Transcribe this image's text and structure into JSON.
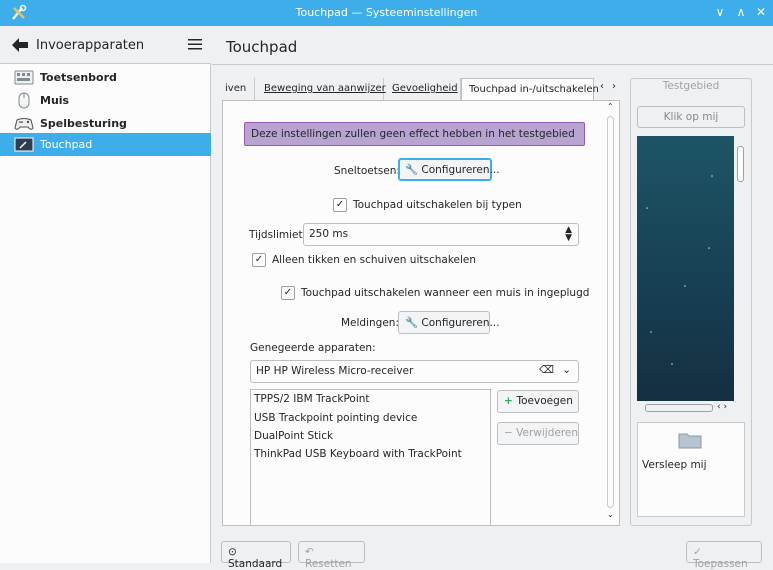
{
  "window": {
    "title": "Touchpad — Systeeminstellingen"
  },
  "sidebar": {
    "header": "Invoerapparaten",
    "items": [
      {
        "label": "Toetsenbord",
        "icon": "keyboard-icon"
      },
      {
        "label": "Muis",
        "icon": "mouse-icon"
      },
      {
        "label": "Spelbesturing",
        "icon": "gamepad-icon"
      },
      {
        "label": "Touchpad",
        "icon": "touchpad-icon",
        "active": true
      }
    ]
  },
  "page_title": "Touchpad",
  "tabs": [
    {
      "label": "iven"
    },
    {
      "label": "Beweging van aanwijzer"
    },
    {
      "label": "Gevoeligheid"
    },
    {
      "label": "Touchpad in-/uitschakelen",
      "active": true
    }
  ],
  "content": {
    "warning": "Deze instellingen zullen geen effect hebben in het testgebied",
    "shortcuts_label": "Sneltoetsen:",
    "configure_label": "Configureren...",
    "disable_typing": "Touchpad uitschakelen bij typen",
    "timeout_label": "Tijdslimiet:",
    "timeout_value": "250 ms",
    "only_tap_scroll": "Alleen tikken en schuiven uitschakelen",
    "disable_mouse": "Touchpad uitschakelen wanneer een muis in ingeplugd",
    "notifications_label": "Meldingen:",
    "ignored_label": "Genegeerde apparaten:",
    "device_input": "HP HP Wireless Micro-receiver",
    "devices": [
      "TPPS/2 IBM TrackPoint",
      "USB Trackpoint pointing device",
      "DualPoint Stick",
      "ThinkPad USB Keyboard with TrackPoint"
    ],
    "add_label": "Toevoegen",
    "remove_label": "Verwijderen"
  },
  "test_area": {
    "title": "Testgebied",
    "click_label": "Klik op mij",
    "drag_label": "Versleep mij"
  },
  "footer": {
    "default_label": "Standaard",
    "reset_label": "Resetten",
    "apply_label": "Toepassen"
  },
  "colors": {
    "accent": "#3daee9",
    "warning_bg": "#b7a4d0"
  }
}
